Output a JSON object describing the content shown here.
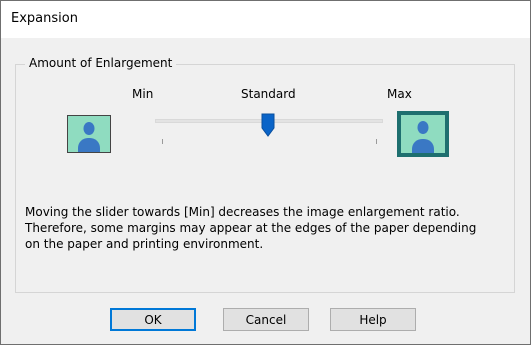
{
  "window": {
    "title": "Expansion"
  },
  "group": {
    "title": "Amount of Enlargement"
  },
  "slider": {
    "min_label": "Min",
    "standard_label": "Standard",
    "max_label": "Max",
    "position": "standard",
    "thumb_color": "#0a64c8"
  },
  "description": {
    "lines": [
      "Moving the slider towards [Min] decreases the image enlargement ratio.",
      "Therefore, some margins may appear at the edges of the paper depending",
      "on the paper and printing environment."
    ]
  },
  "buttons": {
    "ok": "OK",
    "cancel": "Cancel",
    "help": "Help"
  },
  "colors": {
    "image_bg": "#8fdcc0",
    "person": "#3a78c4",
    "selected_frame": "#1e6f6f"
  }
}
